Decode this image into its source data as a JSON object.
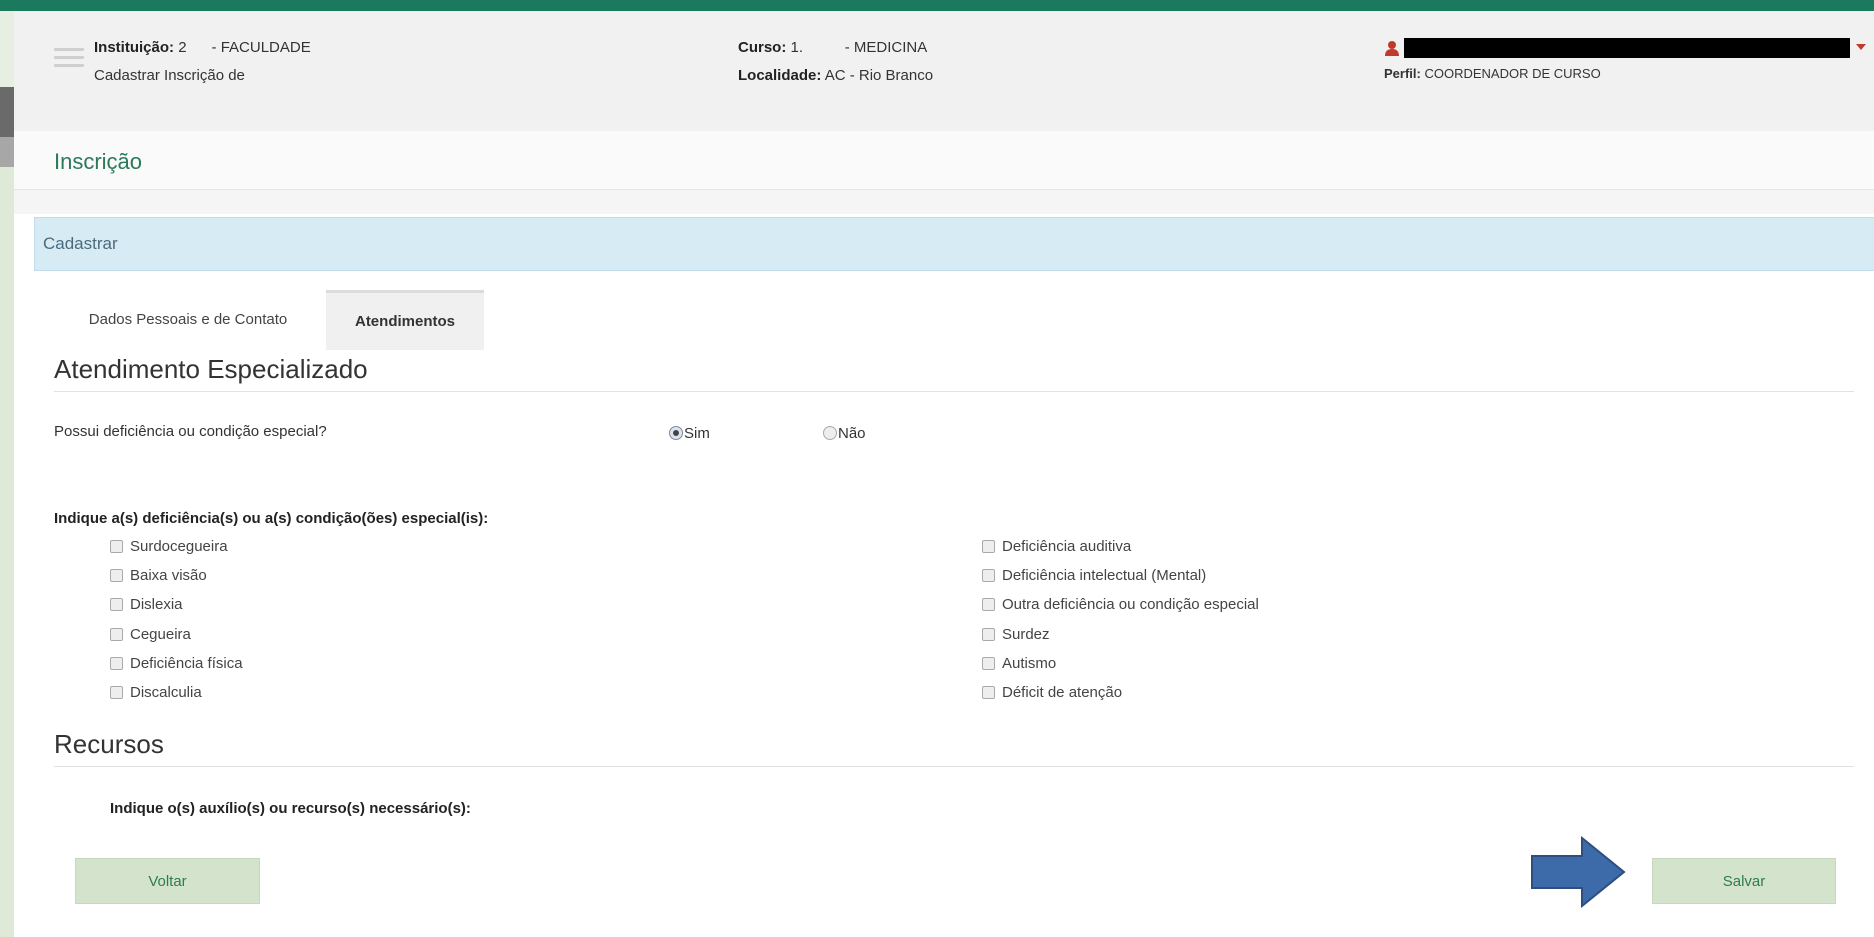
{
  "header": {
    "instituicao_label": "Instituição:",
    "instituicao_value": "2      - FACULDADE",
    "subtitle": "Cadastrar Inscrição de",
    "curso_label": "Curso:",
    "curso_value": "1.          - MEDICINA",
    "localidade_label": "Localidade:",
    "localidade_value": "AC - Rio Branco",
    "perfil_label": "Perfil:",
    "perfil_value": "COORDENADOR DE CURSO",
    "user_icon": "user-icon"
  },
  "page_title": "Inscrição",
  "panel_title": "Cadastrar",
  "tabs": [
    {
      "label": "Dados Pessoais e de Contato",
      "active": false
    },
    {
      "label": "Atendimentos",
      "active": true
    }
  ],
  "atendimento": {
    "title": "Atendimento Especializado",
    "question": "Possui deficiência ou condição especial?",
    "option_sim": "Sim",
    "option_nao": "Não",
    "selected": "Sim",
    "indique_label": "Indique a(s) deficiência(s) ou a(s) condição(ões) especial(is):",
    "left_options": [
      "Surdocegueira",
      "Baixa visão",
      "Dislexia",
      "Cegueira",
      "Deficiência física",
      "Discalculia"
    ],
    "right_options": [
      "Deficiência auditiva",
      "Deficiência intelectual (Mental)",
      "Outra deficiência ou condição especial",
      "Surdez",
      "Autismo",
      "Déficit de atenção"
    ]
  },
  "recursos": {
    "title": "Recursos",
    "indique_label": "Indique o(s) auxílio(s) ou recurso(s) necessário(s):"
  },
  "buttons": {
    "voltar": "Voltar",
    "salvar": "Salvar"
  },
  "colors": {
    "brand_green": "#1b7a5e",
    "title_green": "#2b7a5a",
    "panel_blue": "#d7ebf5",
    "button_green": "#d4e4cc",
    "arrow_blue": "#3d6aa9"
  }
}
